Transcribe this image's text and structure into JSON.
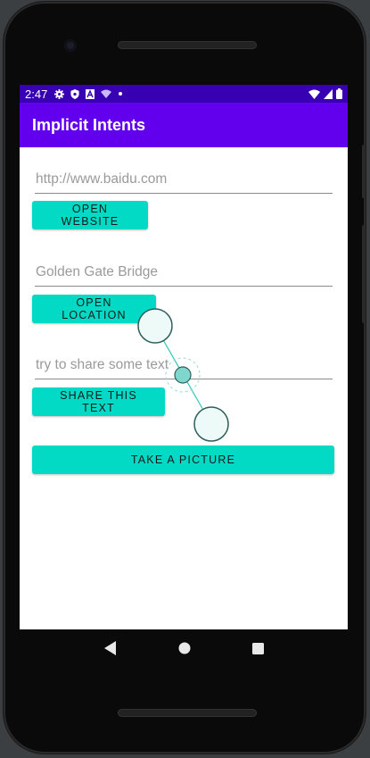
{
  "status_bar": {
    "time": "2:47",
    "icons": [
      "gear-icon",
      "shield-icon",
      "a-icon",
      "wifi-calling-icon",
      "dot-icon"
    ],
    "right_icons": [
      "wifi-icon",
      "signal-icon",
      "battery-icon"
    ]
  },
  "app_bar": {
    "title": "Implicit Intents"
  },
  "website": {
    "placeholder": "http://www.baidu.com",
    "button_label": "OPEN WEBSITE"
  },
  "location": {
    "placeholder": "Golden Gate Bridge",
    "button_label": "OPEN LOCATION"
  },
  "share": {
    "placeholder": "try to share some text",
    "button_label": "SHARE THIS TEXT"
  },
  "camera": {
    "button_label": "TAKE A PICTURE"
  },
  "nav_bar": {
    "buttons": [
      "back-icon",
      "home-icon",
      "recents-icon"
    ]
  },
  "colors": {
    "status_bar": "#3700b3",
    "app_bar": "#6200ee",
    "button": "#03dac5",
    "touch_indicator": "#7fd6cc"
  }
}
